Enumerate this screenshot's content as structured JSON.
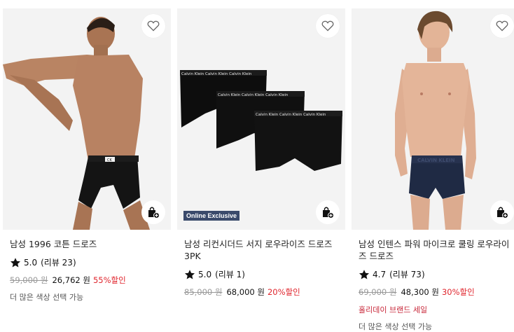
{
  "products": [
    {
      "name": "남성 1996 코튼 드로즈",
      "rating": "5.0",
      "review_text": "(리뷰 23)",
      "original_price": "59,000 원",
      "sale_price": "26,762 원",
      "discount": "55%할인",
      "more_colors": "더 많은 색상 선택 가능",
      "waistband_logo": "CK"
    },
    {
      "name": "남성 리컨시더드 서지 로우라이즈 드로즈 3PK",
      "rating": "5.0",
      "review_text": "(리뷰 1)",
      "original_price": "85,000 원",
      "sale_price": "68,000 원",
      "discount": "20%할인",
      "badge": "Online Exclusive",
      "waistband_text": "Calvin Klein Calvin Klein Calvin Klein"
    },
    {
      "name": "남성 인텐스 파워 마이크로 쿨링 로우라이즈 드로즈",
      "rating": "4.7",
      "review_text": "(리뷰 73)",
      "original_price": "69,000 원",
      "sale_price": "48,300 원",
      "discount": "30%할인",
      "promo": "홀리데이 브랜드 세일",
      "more_colors": "더 많은 색상 선택 가능",
      "waistband_text": "CALVIN KLEIN"
    }
  ],
  "icons": {
    "wishlist": "heart-outline-icon",
    "cart": "shopping-bag-plus-icon",
    "rating": "star-filled-icon"
  },
  "colors": {
    "discount": "#e0262e",
    "promo": "#c8283a",
    "badge_bg": "#3a4a6b",
    "navy_trunk": "#1f2a44",
    "skin": "#d9a888"
  }
}
